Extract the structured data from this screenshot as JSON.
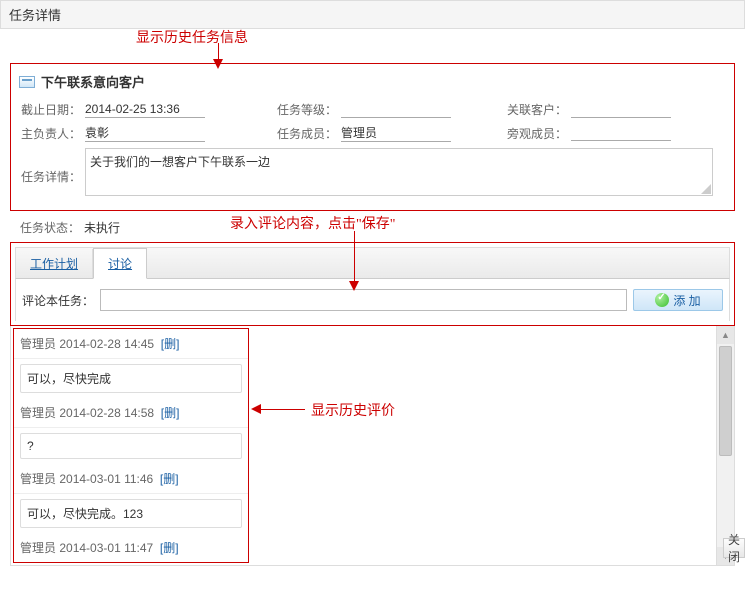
{
  "titlebar": "任务详情",
  "annotations": {
    "history_info": "显示历史任务信息",
    "enter_comment": "录入评论内容，点击\"保存\"",
    "history_comments": "显示历史评价"
  },
  "task": {
    "title": "下午联系意向客户",
    "deadline_label": "截止日期：",
    "deadline_value": "2014-02-25 13:36",
    "level_label": "任务等级：",
    "level_value": "",
    "related_customer_label": "关联客户：",
    "related_customer_value": "",
    "owner_label": "主负责人：",
    "owner_value": "袁彰",
    "members_label": "任务成员：",
    "members_value": "管理员",
    "observers_label": "旁观成员：",
    "observers_value": "",
    "details_label": "任务详情：",
    "details_value": "关于我们的一想客户下午联系一边",
    "status_label": "任务状态：",
    "status_value": "未执行"
  },
  "tabs": {
    "plan": "工作计划",
    "discuss": "讨论"
  },
  "comment": {
    "label": "评论本任务：",
    "add_btn": "添 加"
  },
  "comments": [
    {
      "author": "管理员",
      "time": "2014-02-28 14:45",
      "del": "[删]",
      "body": "可以，尽快完成"
    },
    {
      "author": "管理员",
      "time": "2014-02-28 14:58",
      "del": "[删]",
      "body": "?"
    },
    {
      "author": "管理员",
      "time": "2014-03-01 11:46",
      "del": "[删]",
      "body": "可以，尽快完成。123"
    },
    {
      "author": "管理员",
      "time": "2014-03-01 11:47",
      "del": "[删]",
      "body": ""
    }
  ],
  "footer_btn": "关闭"
}
